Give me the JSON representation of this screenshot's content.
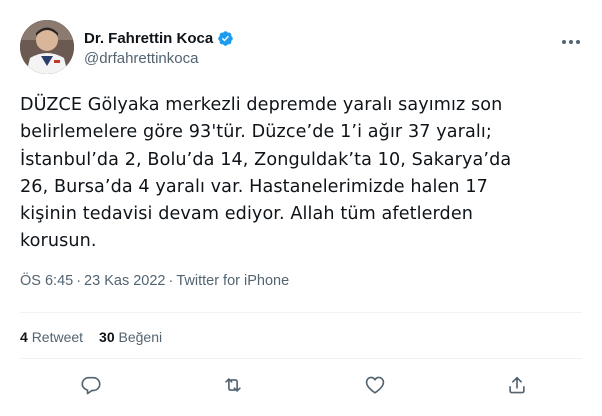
{
  "author": {
    "display_name": "Dr. Fahrettin Koca",
    "handle": "@drfahrettinkoca",
    "verified_icon": "verified-badge-icon"
  },
  "tweet": {
    "text": "DÜZCE Gölyaka merkezli depremde yaralı sayımız son\nbelirlemelere göre 93'tür. Düzce’de 1’i ağır 37 yaralı;\nİstanbul’da 2, Bolu’da 14, Zonguldak’ta 10, Sakarya’da\n26, Bursa’da 4 yaralı var. Hastanelerimizde halen 17\nkişinin tedavisi devam ediyor. Allah tüm afetlerden\nkorusun."
  },
  "meta": {
    "time": "ÖS 6:45",
    "separator": "·",
    "date": "23 Kas 2022",
    "source": "Twitter for iPhone"
  },
  "stats": {
    "retweet_count": "4",
    "retweet_label": "Retweet",
    "like_count": "30",
    "like_label": "Beğeni"
  },
  "actions": {
    "reply_icon": "reply-icon",
    "retweet_icon": "retweet-icon",
    "like_icon": "like-icon",
    "share_icon": "share-icon"
  },
  "colors": {
    "text": "#0f1419",
    "secondary": "#536471",
    "verified": "#1d9bf0",
    "divider": "#eff3f4"
  }
}
